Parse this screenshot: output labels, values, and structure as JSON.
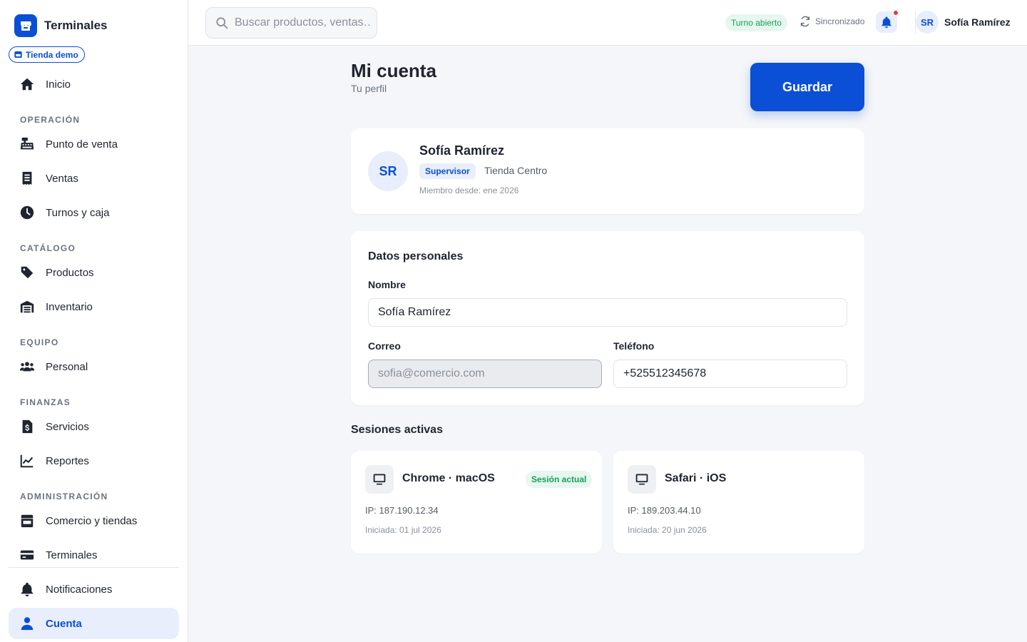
{
  "colors": {
    "accent": "#0a4fd6",
    "success": "#15a05a",
    "danger": "#e5393b",
    "background": "#f4f6f9"
  },
  "sidebar": {
    "brand": "Terminales",
    "store_chip": "Tienda demo",
    "items": [
      {
        "label": "Inicio",
        "icon": "home-icon"
      },
      {
        "section": "OPERACIÓN"
      },
      {
        "label": "Punto de venta",
        "icon": "cash-register-icon"
      },
      {
        "label": "Ventas",
        "icon": "receipt-icon"
      },
      {
        "label": "Turnos y caja",
        "icon": "clock-icon"
      },
      {
        "section": "CATÁLOGO"
      },
      {
        "label": "Productos",
        "icon": "tag-icon"
      },
      {
        "label": "Inventario",
        "icon": "warehouse-icon"
      },
      {
        "section": "EQUIPO"
      },
      {
        "label": "Personal",
        "icon": "users-icon"
      },
      {
        "section": "FINANZAS"
      },
      {
        "label": "Servicios",
        "icon": "invoice-dollar-icon"
      },
      {
        "label": "Reportes",
        "icon": "chart-line-icon"
      },
      {
        "section": "ADMINISTRACIÓN"
      },
      {
        "label": "Comercio y tiendas",
        "icon": "store-icon"
      },
      {
        "label": "Terminales",
        "icon": "card-icon"
      },
      {
        "label": "Notificaciones",
        "icon": "bell-icon"
      },
      {
        "label": "Cuenta",
        "icon": "user-icon",
        "active": true
      }
    ]
  },
  "topbar": {
    "search_placeholder": "Buscar productos, ventas…",
    "shift_status": "Turno abierto",
    "sync_status": "Sincronizado",
    "user_initials": "SR",
    "user_name": "Sofía Ramírez"
  },
  "page": {
    "title": "Mi cuenta",
    "subtitle": "Tu perfil",
    "save_label": "Guardar"
  },
  "profile": {
    "initials": "SR",
    "name": "Sofía Ramírez",
    "role": "Supervisor",
    "store": "Tienda Centro",
    "member_since": "Miembro desde: ene 2026"
  },
  "personal": {
    "title": "Datos personales",
    "name_label": "Nombre",
    "name_value": "Sofía Ramírez",
    "email_label": "Correo",
    "email_value": "sofia@comercio.com",
    "phone_label": "Teléfono",
    "phone_value": "+525512345678"
  },
  "sessions": {
    "title": "Sesiones activas",
    "items": [
      {
        "device": "Chrome · macOS",
        "badge": "Sesión actual",
        "ip": "IP: 187.190.12.34",
        "started": "Iniciada: 01 jul 2026"
      },
      {
        "device": "Safari · iOS",
        "ip": "IP: 189.203.44.10",
        "started": "Iniciada: 20 jun 2026"
      }
    ]
  }
}
